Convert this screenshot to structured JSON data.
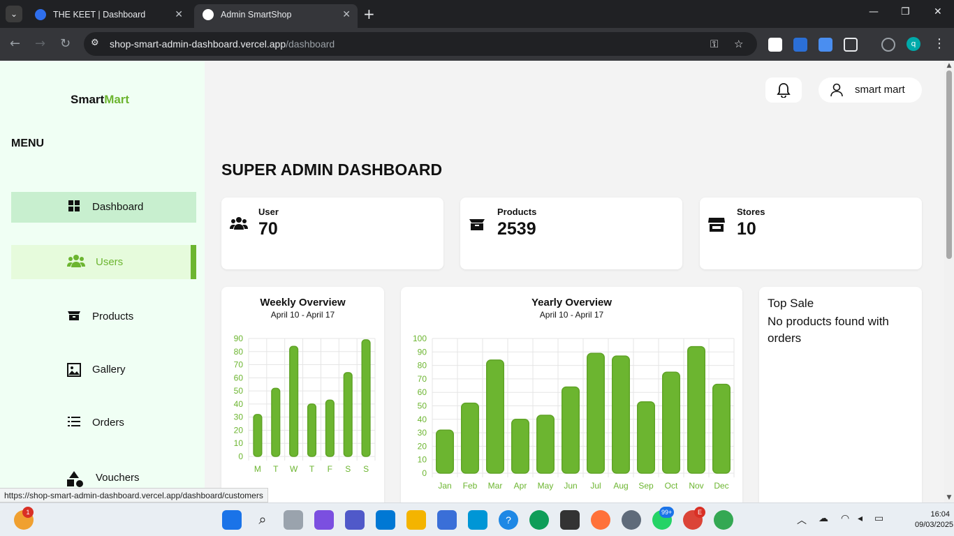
{
  "browser": {
    "tabs": [
      {
        "title": "THE KEET | Dashboard",
        "active": false
      },
      {
        "title": "Admin SmartShop",
        "active": true
      }
    ],
    "url_host": "shop-smart-admin-dashboard.vercel.app",
    "url_path": "/dashboard",
    "status_url": "https://shop-smart-admin-dashboard.vercel.app/dashboard/customers",
    "profile_initial": "q"
  },
  "sidebar": {
    "logo_part1": "Smart",
    "logo_part2": "Mart",
    "menu_title": "MENU",
    "items": [
      {
        "label": "Dashboard",
        "icon": "grid-icon"
      },
      {
        "label": "Users",
        "icon": "users-icon"
      },
      {
        "label": "Products",
        "icon": "box-icon"
      },
      {
        "label": "Gallery",
        "icon": "image-icon"
      },
      {
        "label": "Orders",
        "icon": "list-icon"
      },
      {
        "label": "Vouchers",
        "icon": "shapes-icon"
      }
    ]
  },
  "header": {
    "user_name": "smart mart"
  },
  "main": {
    "title": "SUPER ADMIN DASHBOARD",
    "stats": [
      {
        "label": "User",
        "value": "70"
      },
      {
        "label": "Products",
        "value": "2539"
      },
      {
        "label": "Stores",
        "value": "10"
      }
    ],
    "top_sale": {
      "title": "Top Sale",
      "message": "No products found with orders"
    }
  },
  "colors": {
    "accent": "#6cb530",
    "bar": "#6cb530",
    "sidebar_bg": "#f0fff4"
  },
  "chart_data": [
    {
      "type": "bar",
      "title": "Weekly Overview",
      "subtitle": "April 10 - April 17",
      "categories": [
        "M",
        "T",
        "W",
        "T",
        "F",
        "S",
        "S"
      ],
      "values": [
        32,
        52,
        84,
        40,
        43,
        64,
        89
      ],
      "ylim": [
        0,
        90
      ],
      "yticks": [
        0,
        10,
        20,
        30,
        40,
        50,
        60,
        70,
        80,
        90
      ],
      "grid": true
    },
    {
      "type": "bar",
      "title": "Yearly Overview",
      "subtitle": "April 10 - April 17",
      "categories": [
        "Jan",
        "Feb",
        "Mar",
        "Apr",
        "May",
        "Jun",
        "Jul",
        "Aug",
        "Sep",
        "Oct",
        "Nov",
        "Dec"
      ],
      "values": [
        32,
        52,
        84,
        40,
        43,
        64,
        89,
        87,
        53,
        75,
        94,
        66
      ],
      "ylim": [
        0,
        100
      ],
      "yticks": [
        0,
        10,
        20,
        30,
        40,
        50,
        60,
        70,
        80,
        90,
        100
      ],
      "grid": true
    }
  ],
  "taskbar": {
    "weather_badge": "1",
    "whatsapp_badge": "99+",
    "edge_badge": "E",
    "time": "16:04",
    "date": "09/03/2025"
  }
}
